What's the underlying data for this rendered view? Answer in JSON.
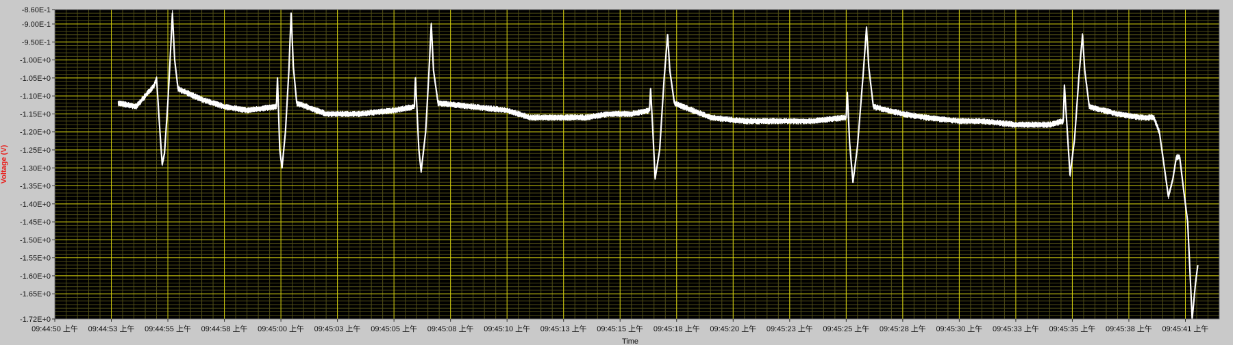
{
  "chart_data": {
    "type": "line",
    "title": "",
    "xlabel": "Time",
    "ylabel": "Voltage (V)",
    "ylabel_color": "#e8221f",
    "plot_background": "#000000",
    "grid_major_color": "#d6d20c",
    "grid_minor_color": "#4f4d17",
    "trace_color": "#ffffff",
    "grid": true,
    "legend": "none",
    "x_range_seconds": [
      0,
      51.5
    ],
    "x_start_label": "09:44:50 上午",
    "ylim": [
      -1.72,
      -0.86
    ],
    "y_ticks": [
      {
        "value": -0.86,
        "label": "-8.60E-1"
      },
      {
        "value": -0.9,
        "label": "-9.00E-1"
      },
      {
        "value": -0.95,
        "label": "-9.50E-1"
      },
      {
        "value": -1.0,
        "label": "-1.00E+0"
      },
      {
        "value": -1.05,
        "label": "-1.05E+0"
      },
      {
        "value": -1.1,
        "label": "-1.10E+0"
      },
      {
        "value": -1.15,
        "label": "-1.15E+0"
      },
      {
        "value": -1.2,
        "label": "-1.20E+0"
      },
      {
        "value": -1.25,
        "label": "-1.25E+0"
      },
      {
        "value": -1.3,
        "label": "-1.30E+0"
      },
      {
        "value": -1.35,
        "label": "-1.35E+0"
      },
      {
        "value": -1.4,
        "label": "-1.40E+0"
      },
      {
        "value": -1.45,
        "label": "-1.45E+0"
      },
      {
        "value": -1.5,
        "label": "-1.50E+0"
      },
      {
        "value": -1.55,
        "label": "-1.55E+0"
      },
      {
        "value": -1.6,
        "label": "-1.60E+0"
      },
      {
        "value": -1.65,
        "label": "-1.65E+0"
      },
      {
        "value": -1.72,
        "label": "-1.72E+0"
      }
    ],
    "x_ticks": [
      {
        "value": 0.0,
        "label": "09:44:50 上午"
      },
      {
        "value": 2.5,
        "label": "09:44:53 上午"
      },
      {
        "value": 5.0,
        "label": "09:44:55 上午"
      },
      {
        "value": 7.5,
        "label": "09:44:58 上午"
      },
      {
        "value": 10.0,
        "label": "09:45:00 上午"
      },
      {
        "value": 12.5,
        "label": "09:45:03 上午"
      },
      {
        "value": 15.0,
        "label": "09:45:05 上午"
      },
      {
        "value": 17.5,
        "label": "09:45:08 上午"
      },
      {
        "value": 20.0,
        "label": "09:45:10 上午"
      },
      {
        "value": 22.5,
        "label": "09:45:13 上午"
      },
      {
        "value": 25.0,
        "label": "09:45:15 上午"
      },
      {
        "value": 27.5,
        "label": "09:45:18 上午"
      },
      {
        "value": 30.0,
        "label": "09:45:20 上午"
      },
      {
        "value": 32.5,
        "label": "09:45:23 上午"
      },
      {
        "value": 35.0,
        "label": "09:45:25 上午"
      },
      {
        "value": 37.5,
        "label": "09:45:28 上午"
      },
      {
        "value": 40.0,
        "label": "09:45:30 上午"
      },
      {
        "value": 42.5,
        "label": "09:45:33 上午"
      },
      {
        "value": 45.0,
        "label": "09:45:35 上午"
      },
      {
        "value": 47.5,
        "label": "09:45:38 上午"
      },
      {
        "value": 50.0,
        "label": "09:45:41 上午"
      }
    ],
    "series": [
      {
        "noise_band": 0.018,
        "points": [
          [
            2.8,
            -1.12
          ],
          [
            3.6,
            -1.13
          ],
          [
            4.4,
            -1.07
          ],
          [
            4.5,
            -1.05
          ],
          [
            4.65,
            -1.2
          ],
          [
            4.75,
            -1.29
          ],
          [
            4.85,
            -1.26
          ],
          [
            5.0,
            -1.12
          ],
          [
            5.1,
            -1.0
          ],
          [
            5.2,
            -0.87
          ],
          [
            5.3,
            -1.0
          ],
          [
            5.45,
            -1.08
          ],
          [
            6.5,
            -1.11
          ],
          [
            7.5,
            -1.13
          ],
          [
            8.5,
            -1.14
          ],
          [
            9.8,
            -1.13
          ],
          [
            9.85,
            -1.05
          ],
          [
            9.95,
            -1.25
          ],
          [
            10.05,
            -1.3
          ],
          [
            10.2,
            -1.2
          ],
          [
            10.35,
            -1.03
          ],
          [
            10.45,
            -0.87
          ],
          [
            10.55,
            -1.02
          ],
          [
            10.7,
            -1.12
          ],
          [
            12.0,
            -1.15
          ],
          [
            13.5,
            -1.15
          ],
          [
            15.0,
            -1.14
          ],
          [
            15.9,
            -1.13
          ],
          [
            15.95,
            -1.05
          ],
          [
            16.1,
            -1.25
          ],
          [
            16.2,
            -1.31
          ],
          [
            16.4,
            -1.2
          ],
          [
            16.55,
            -1.03
          ],
          [
            16.65,
            -0.9
          ],
          [
            16.75,
            -1.03
          ],
          [
            16.95,
            -1.12
          ],
          [
            18.5,
            -1.13
          ],
          [
            20.0,
            -1.14
          ],
          [
            21.0,
            -1.16
          ],
          [
            22.0,
            -1.16
          ],
          [
            23.5,
            -1.16
          ],
          [
            24.5,
            -1.15
          ],
          [
            25.5,
            -1.15
          ],
          [
            26.3,
            -1.14
          ],
          [
            26.35,
            -1.08
          ],
          [
            26.45,
            -1.2
          ],
          [
            26.55,
            -1.33
          ],
          [
            26.75,
            -1.25
          ],
          [
            26.95,
            -1.05
          ],
          [
            27.1,
            -0.93
          ],
          [
            27.2,
            -1.03
          ],
          [
            27.4,
            -1.12
          ],
          [
            29.0,
            -1.16
          ],
          [
            30.5,
            -1.17
          ],
          [
            32.0,
            -1.17
          ],
          [
            33.5,
            -1.17
          ],
          [
            35.0,
            -1.16
          ],
          [
            35.05,
            -1.09
          ],
          [
            35.15,
            -1.23
          ],
          [
            35.3,
            -1.34
          ],
          [
            35.5,
            -1.24
          ],
          [
            35.75,
            -1.04
          ],
          [
            35.9,
            -0.91
          ],
          [
            36.0,
            -1.02
          ],
          [
            36.2,
            -1.13
          ],
          [
            37.5,
            -1.15
          ],
          [
            38.5,
            -1.16
          ],
          [
            40.0,
            -1.17
          ],
          [
            41.0,
            -1.17
          ],
          [
            42.5,
            -1.18
          ],
          [
            44.0,
            -1.18
          ],
          [
            44.6,
            -1.17
          ],
          [
            44.65,
            -1.07
          ],
          [
            44.8,
            -1.22
          ],
          [
            44.9,
            -1.32
          ],
          [
            45.1,
            -1.22
          ],
          [
            45.3,
            -1.04
          ],
          [
            45.45,
            -0.93
          ],
          [
            45.55,
            -1.03
          ],
          [
            45.75,
            -1.13
          ],
          [
            47.0,
            -1.15
          ],
          [
            48.0,
            -1.16
          ],
          [
            48.6,
            -1.16
          ],
          [
            48.85,
            -1.2
          ],
          [
            49.05,
            -1.29
          ],
          [
            49.25,
            -1.38
          ],
          [
            49.45,
            -1.33
          ],
          [
            49.6,
            -1.27
          ],
          [
            49.75,
            -1.27
          ],
          [
            49.9,
            -1.35
          ],
          [
            50.1,
            -1.45
          ],
          [
            50.3,
            -1.72
          ],
          [
            50.45,
            -1.62
          ],
          [
            50.55,
            -1.57
          ]
        ]
      }
    ]
  }
}
